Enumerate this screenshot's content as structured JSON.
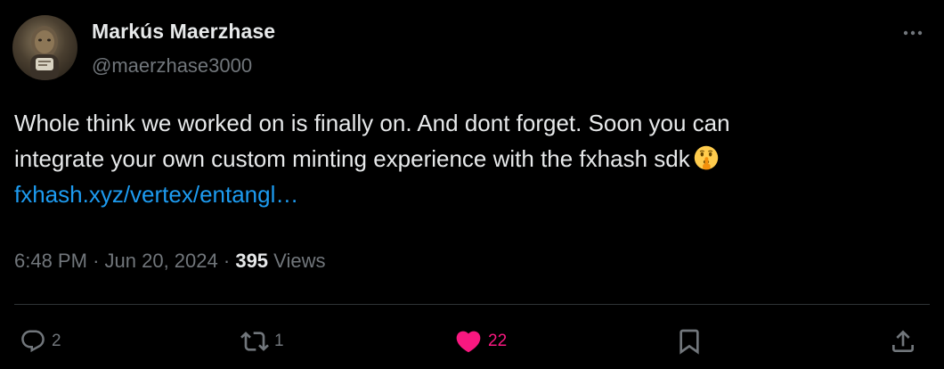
{
  "author": {
    "display_name": "Markús Maerzhase",
    "handle": "@maerzhase3000"
  },
  "tweet": {
    "text_line_1": "Whole think we worked on is finally on. And dont forget. Soon you can",
    "text_line_2": "integrate your own custom minting experience with the fxhash sdk",
    "emoji": "shushing-face",
    "link_text": "fxhash.xyz/vertex/entangl…",
    "time": "6:48 PM",
    "separator": "·",
    "date": "Jun 20, 2024",
    "views_count": "395",
    "views_label": "Views"
  },
  "actions": {
    "replies": "2",
    "reposts": "1",
    "likes": "22",
    "liked": true
  },
  "colors": {
    "background": "#000000",
    "text": "#e7e9ea",
    "muted": "#71767b",
    "link": "#1d9bf0",
    "like": "#f91880",
    "divider": "#2f3336"
  }
}
